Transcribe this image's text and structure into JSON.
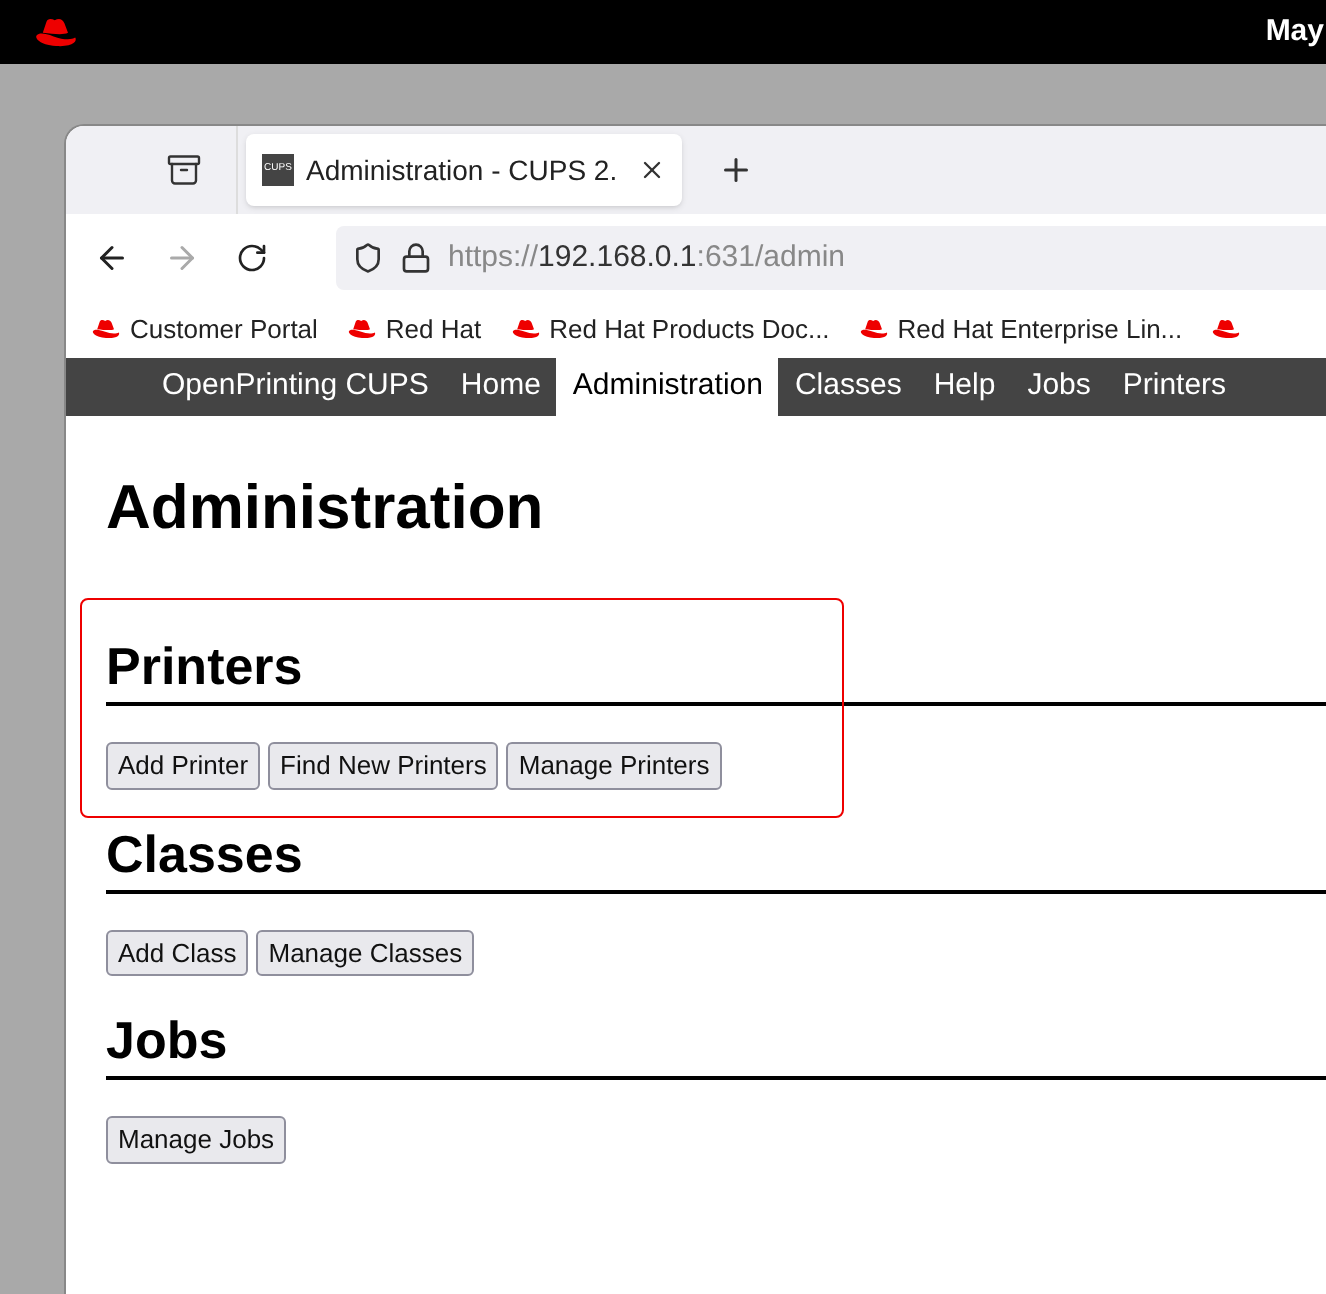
{
  "top_bar": {
    "clock": "May"
  },
  "browser": {
    "tab": {
      "title": "Administration - CUPS 2.",
      "favicon": "CUPS",
      "selected": true
    },
    "navigation": {
      "back_disabled": false,
      "forward_disabled": true
    },
    "url": {
      "scheme": "https://",
      "host": "192.168.0.1",
      "rest": ":631/admin"
    },
    "bookmarks": [
      {
        "kind": "labeled",
        "label": "Customer Portal"
      },
      {
        "kind": "labeled",
        "label": "Red Hat"
      },
      {
        "kind": "labeled",
        "label": "Red Hat Products Doc..."
      },
      {
        "kind": "labeled",
        "label": "Red Hat Enterprise Lin..."
      },
      {
        "kind": "icon"
      }
    ]
  },
  "site_nav": [
    {
      "label": "OpenPrinting CUPS",
      "selected": false
    },
    {
      "label": "Home",
      "selected": false
    },
    {
      "label": "Administration",
      "selected": true
    },
    {
      "label": "Classes",
      "selected": false
    },
    {
      "label": "Help",
      "selected": false
    },
    {
      "label": "Jobs",
      "selected": false
    },
    {
      "label": "Printers",
      "selected": false
    }
  ],
  "page_title": "Administration",
  "sections": [
    {
      "title": "Printers",
      "highlighted": true,
      "buttons": [
        "Add Printer",
        "Find New Printers",
        "Manage Printers"
      ]
    },
    {
      "title": "Classes",
      "highlighted": false,
      "buttons": [
        "Add Class",
        "Manage Classes"
      ]
    },
    {
      "title": "Jobs",
      "highlighted": false,
      "buttons": [
        "Manage Jobs"
      ]
    }
  ]
}
